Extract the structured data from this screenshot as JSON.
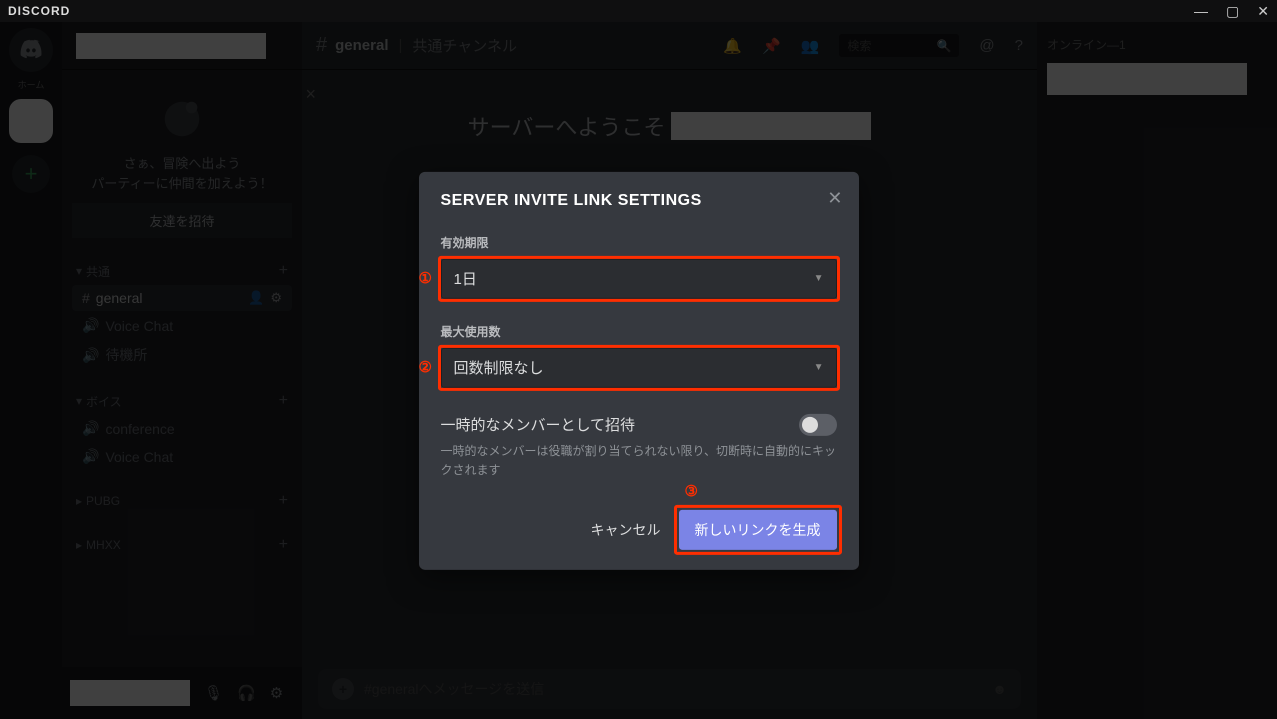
{
  "brand": "DISCORD",
  "rail": {
    "label": "ホーム"
  },
  "sidebar": {
    "onboard_line1": "さぁ、冒険へ出よう",
    "onboard_line2": "パーティーに仲間を加えよう！",
    "invite_button": "友達を招待",
    "cat_shared": "共通",
    "cat_voice": "ボイス",
    "chan_general": "general",
    "chan_voicechat": "Voice Chat",
    "chan_waiting": "待機所",
    "chan_conference": "conference",
    "chan_voicechat2": "Voice Chat",
    "cat_pubg": "PUBG",
    "cat_mhxx": "MHXX"
  },
  "header": {
    "channel": "general",
    "subtitle": "共通チャンネル",
    "search_placeholder": "検索"
  },
  "welcome_prefix": "サーバーへようこそ",
  "composer_placeholder": "#generalへメッセージを送信",
  "members": {
    "online_label": "オンライン—1"
  },
  "modal": {
    "title": "SERVER INVITE LINK SETTINGS",
    "expire_label": "有効期限",
    "expire_value": "1日",
    "max_label": "最大使用数",
    "max_value": "回数制限なし",
    "temp_label": "一時的なメンバーとして招待",
    "temp_desc": "一時的なメンバーは役職が割り当てられない限り、切断時に自動的にキックされます",
    "cancel": "キャンセル",
    "submit": "新しいリンクを生成",
    "ann1": "①",
    "ann2": "②",
    "ann3": "③"
  }
}
